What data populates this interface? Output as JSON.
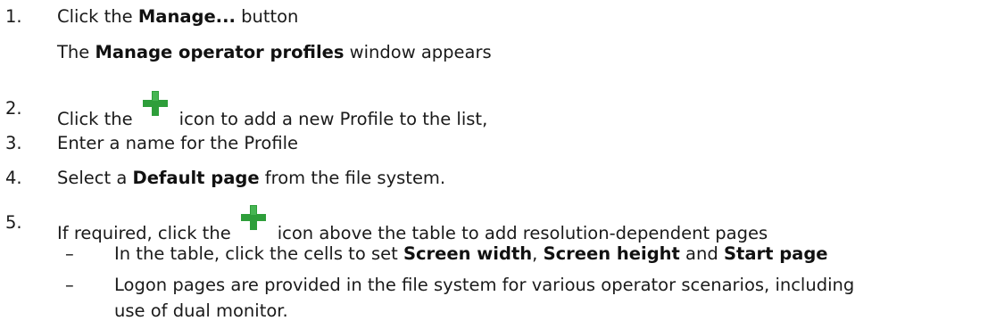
{
  "steps": [
    {
      "num": "1.",
      "pre": "Click the ",
      "bold": "Manage...",
      "post": " button"
    },
    {
      "num": "",
      "pre": "The ",
      "bold": "Manage operator profiles",
      "post": " window appears"
    },
    {
      "num": "2.",
      "pre": "Click the",
      "icon": "add-plus-icon",
      "post": "icon to add a new Profile to the list,"
    },
    {
      "num": "3.",
      "text": "Enter a name for the Profile"
    },
    {
      "num": "4.",
      "pre": "Select a ",
      "bold": "Default page",
      "post": " from the file system."
    },
    {
      "num": "5.",
      "pre": "If required, click the",
      "icon": "add-plus-icon",
      "post": "icon above the table to add resolution-dependent pages"
    }
  ],
  "substeps": [
    {
      "dash": "–",
      "pre": "In the table, click the cells to set ",
      "b1": "Screen width",
      "mid1": ", ",
      "b2": "Screen height",
      "mid2": " and ",
      "b3": "Start page"
    },
    {
      "dash": "–",
      "line1": "Logon pages are provided in the file system for various operator scenarios, including",
      "line2": "use of dual monitor."
    }
  ],
  "colors": {
    "plus_icon": "#2e9e3a",
    "text": "#1a1a1a"
  }
}
